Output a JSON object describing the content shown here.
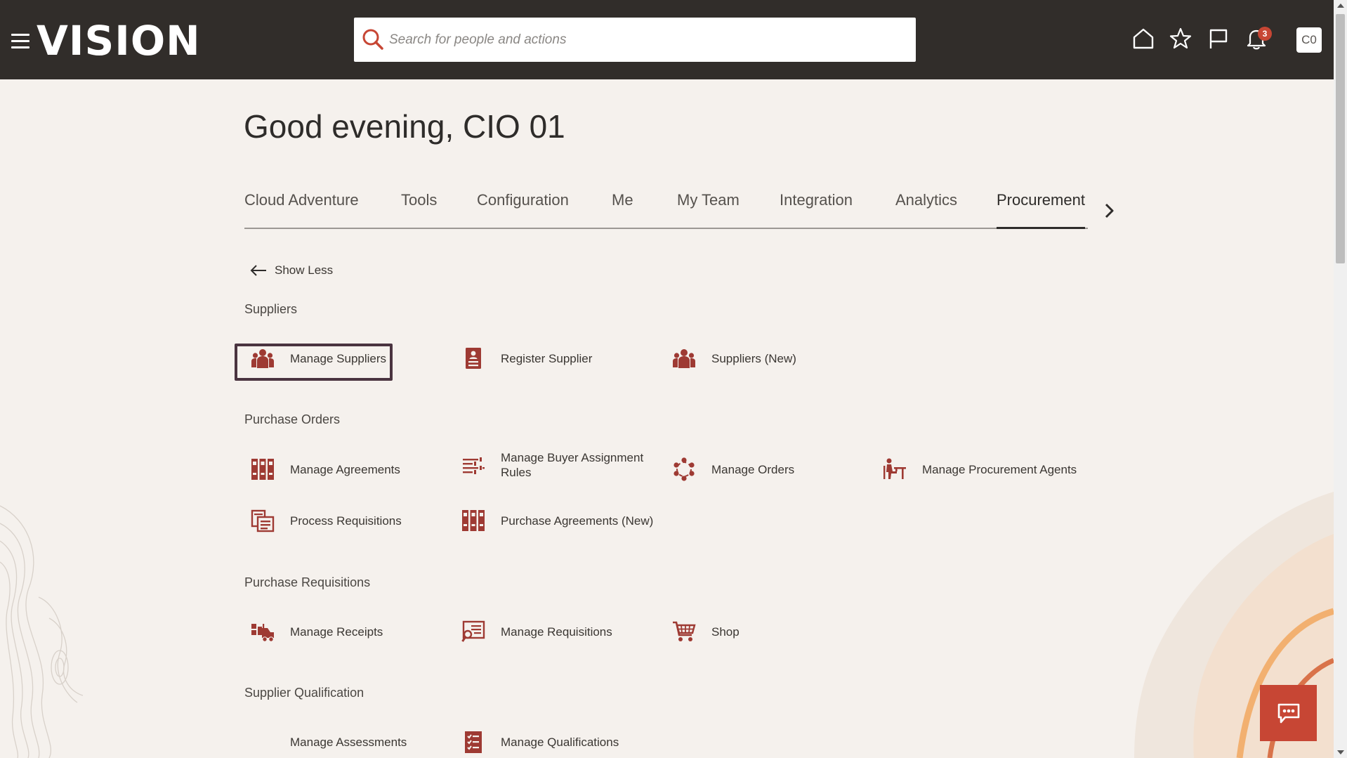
{
  "header": {
    "logo_text": "VISION",
    "search_placeholder": "Search for people and actions",
    "notification_count": "3",
    "avatar_initials": "C0"
  },
  "greeting": "Good evening, CIO 01",
  "tabs": [
    {
      "label": "Cloud Adventure"
    },
    {
      "label": "Tools"
    },
    {
      "label": "Configuration"
    },
    {
      "label": "Me"
    },
    {
      "label": "My Team"
    },
    {
      "label": "Integration"
    },
    {
      "label": "Analytics"
    },
    {
      "label": "Procurement"
    }
  ],
  "active_tab": "Procurement",
  "show_less_label": "Show Less",
  "sections": {
    "suppliers": {
      "title": "Suppliers",
      "items": [
        "Manage Suppliers",
        "Register Supplier",
        "Suppliers (New)"
      ]
    },
    "purchase_orders": {
      "title": "Purchase Orders",
      "items": [
        "Manage Agreements",
        "Manage Buyer Assignment Rules",
        "Manage Orders",
        "Manage Procurement Agents",
        "Process Requisitions",
        "Purchase Agreements (New)"
      ]
    },
    "purchase_requisitions": {
      "title": "Purchase Requisitions",
      "items": [
        "Manage Receipts",
        "Manage Requisitions",
        "Shop"
      ]
    },
    "supplier_qualification": {
      "title": "Supplier Qualification",
      "items": [
        "Manage Assessments",
        "Manage Qualifications"
      ]
    }
  },
  "colors": {
    "header_bg": "#312d2a",
    "page_bg": "#f5f1ed",
    "accent": "#c74634",
    "icon": "#9e3a33",
    "focus_border": "#4a3440"
  }
}
